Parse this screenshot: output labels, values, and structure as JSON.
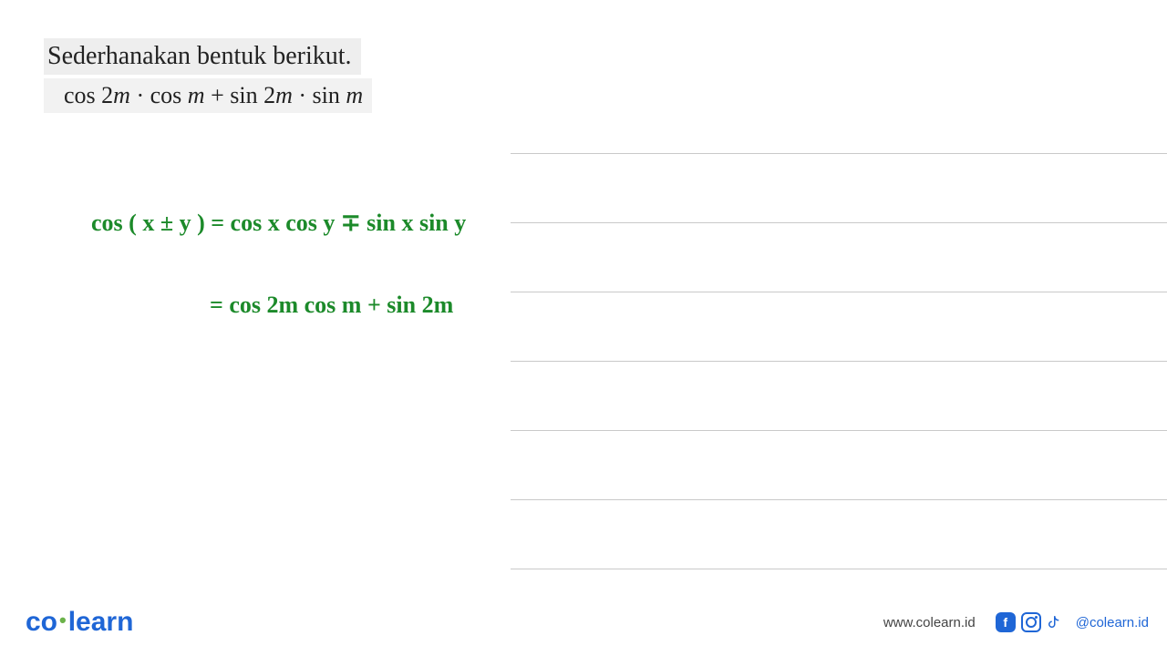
{
  "problem": {
    "title": "Sederhanakan bentuk berikut.",
    "expression_plain": "cos 2m · cos m + sin 2m · sin m"
  },
  "handwriting": {
    "line1": "cos ( x ± y )  =  cos x cos y  ∓  sin x sin y",
    "line2": "=  cos 2m  cos m  +  sin 2m"
  },
  "footer": {
    "logo_co": "co",
    "logo_learn": "learn",
    "url": "www.colearn.id",
    "handle": "@colearn.id"
  },
  "icons": {
    "facebook": "facebook-icon",
    "instagram": "instagram-icon",
    "tiktok": "tiktok-icon"
  }
}
